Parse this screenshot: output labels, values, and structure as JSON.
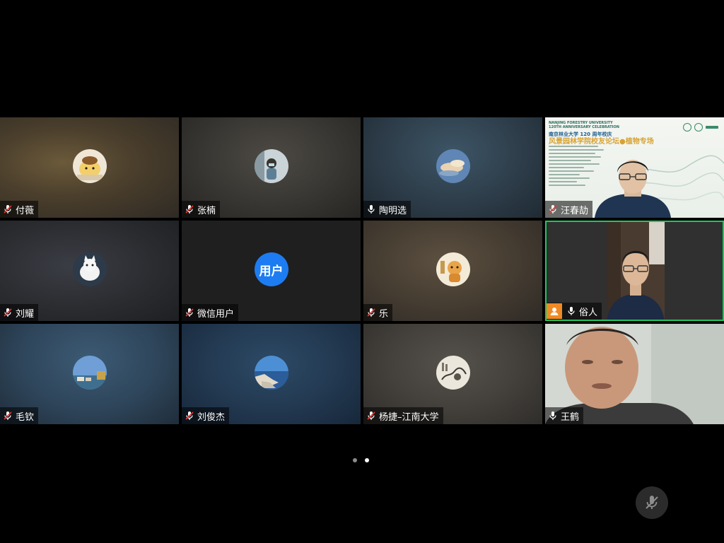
{
  "participants": [
    {
      "name": "付薇",
      "mic": "muted",
      "avatar": "pompompurin-avatar"
    },
    {
      "name": "张楠",
      "mic": "muted",
      "avatar": "person-photo-avatar"
    },
    {
      "name": "陶明选",
      "mic": "on",
      "avatar": "sky-clouds-avatar"
    },
    {
      "name": "汪春劼",
      "mic": "muted",
      "video": "screen-share-with-camera"
    },
    {
      "name": "刘耀",
      "mic": "muted",
      "avatar": "white-cat-avatar"
    },
    {
      "name": "微信用户",
      "mic": "muted",
      "avatar_text": "用户"
    },
    {
      "name": "乐",
      "mic": "muted",
      "avatar": "cartoon-character-avatar"
    },
    {
      "name": "俗人",
      "mic": "on",
      "video": "camera-on",
      "host": true,
      "active_speaker": true
    },
    {
      "name": "毛钦",
      "mic": "muted",
      "avatar": "coastal-town-avatar"
    },
    {
      "name": "刘俊杰",
      "mic": "muted",
      "avatar": "seaside-rocks-avatar"
    },
    {
      "name": "杨捷–江南大学",
      "mic": "muted",
      "avatar": "ink-painting-avatar"
    },
    {
      "name": "王鹤",
      "mic": "on",
      "video": "camera-on"
    }
  ],
  "slide": {
    "line1": "NANJING FORESTRY UNIVERSITY",
    "line2": "120TH ANNIVERSARY CELEBRATION",
    "title_cn": "南京林业大学 120 周年校庆",
    "headline": "风景园林学院校友论坛●植物专场"
  },
  "pager": {
    "pages": 2,
    "current": 2
  },
  "colors": {
    "background": "#000000",
    "active_speaker_border": "#22c55e",
    "host_badge": "#f08a24",
    "avatar_text_bg": "#1d7cf2"
  }
}
